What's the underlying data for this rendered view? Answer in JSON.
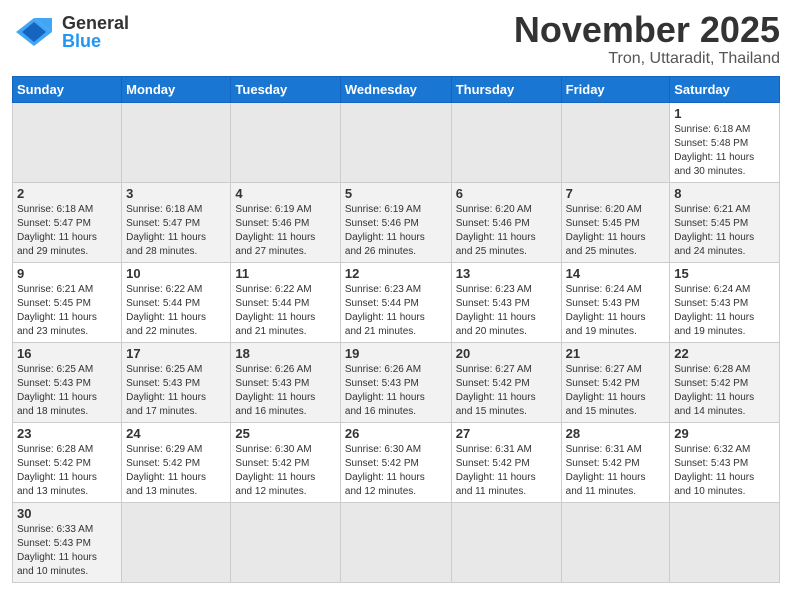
{
  "header": {
    "logo_general": "General",
    "logo_blue": "Blue",
    "month": "November 2025",
    "location": "Tron, Uttaradit, Thailand"
  },
  "weekdays": [
    "Sunday",
    "Monday",
    "Tuesday",
    "Wednesday",
    "Thursday",
    "Friday",
    "Saturday"
  ],
  "weeks": [
    [
      {
        "day": "",
        "info": ""
      },
      {
        "day": "",
        "info": ""
      },
      {
        "day": "",
        "info": ""
      },
      {
        "day": "",
        "info": ""
      },
      {
        "day": "",
        "info": ""
      },
      {
        "day": "",
        "info": ""
      },
      {
        "day": "1",
        "info": "Sunrise: 6:18 AM\nSunset: 5:48 PM\nDaylight: 11 hours\nand 30 minutes."
      }
    ],
    [
      {
        "day": "2",
        "info": "Sunrise: 6:18 AM\nSunset: 5:47 PM\nDaylight: 11 hours\nand 29 minutes."
      },
      {
        "day": "3",
        "info": "Sunrise: 6:18 AM\nSunset: 5:47 PM\nDaylight: 11 hours\nand 28 minutes."
      },
      {
        "day": "4",
        "info": "Sunrise: 6:19 AM\nSunset: 5:46 PM\nDaylight: 11 hours\nand 27 minutes."
      },
      {
        "day": "5",
        "info": "Sunrise: 6:19 AM\nSunset: 5:46 PM\nDaylight: 11 hours\nand 26 minutes."
      },
      {
        "day": "6",
        "info": "Sunrise: 6:20 AM\nSunset: 5:46 PM\nDaylight: 11 hours\nand 25 minutes."
      },
      {
        "day": "7",
        "info": "Sunrise: 6:20 AM\nSunset: 5:45 PM\nDaylight: 11 hours\nand 25 minutes."
      },
      {
        "day": "8",
        "info": "Sunrise: 6:21 AM\nSunset: 5:45 PM\nDaylight: 11 hours\nand 24 minutes."
      }
    ],
    [
      {
        "day": "9",
        "info": "Sunrise: 6:21 AM\nSunset: 5:45 PM\nDaylight: 11 hours\nand 23 minutes."
      },
      {
        "day": "10",
        "info": "Sunrise: 6:22 AM\nSunset: 5:44 PM\nDaylight: 11 hours\nand 22 minutes."
      },
      {
        "day": "11",
        "info": "Sunrise: 6:22 AM\nSunset: 5:44 PM\nDaylight: 11 hours\nand 21 minutes."
      },
      {
        "day": "12",
        "info": "Sunrise: 6:23 AM\nSunset: 5:44 PM\nDaylight: 11 hours\nand 21 minutes."
      },
      {
        "day": "13",
        "info": "Sunrise: 6:23 AM\nSunset: 5:43 PM\nDaylight: 11 hours\nand 20 minutes."
      },
      {
        "day": "14",
        "info": "Sunrise: 6:24 AM\nSunset: 5:43 PM\nDaylight: 11 hours\nand 19 minutes."
      },
      {
        "day": "15",
        "info": "Sunrise: 6:24 AM\nSunset: 5:43 PM\nDaylight: 11 hours\nand 19 minutes."
      }
    ],
    [
      {
        "day": "16",
        "info": "Sunrise: 6:25 AM\nSunset: 5:43 PM\nDaylight: 11 hours\nand 18 minutes."
      },
      {
        "day": "17",
        "info": "Sunrise: 6:25 AM\nSunset: 5:43 PM\nDaylight: 11 hours\nand 17 minutes."
      },
      {
        "day": "18",
        "info": "Sunrise: 6:26 AM\nSunset: 5:43 PM\nDaylight: 11 hours\nand 16 minutes."
      },
      {
        "day": "19",
        "info": "Sunrise: 6:26 AM\nSunset: 5:43 PM\nDaylight: 11 hours\nand 16 minutes."
      },
      {
        "day": "20",
        "info": "Sunrise: 6:27 AM\nSunset: 5:42 PM\nDaylight: 11 hours\nand 15 minutes."
      },
      {
        "day": "21",
        "info": "Sunrise: 6:27 AM\nSunset: 5:42 PM\nDaylight: 11 hours\nand 15 minutes."
      },
      {
        "day": "22",
        "info": "Sunrise: 6:28 AM\nSunset: 5:42 PM\nDaylight: 11 hours\nand 14 minutes."
      }
    ],
    [
      {
        "day": "23",
        "info": "Sunrise: 6:28 AM\nSunset: 5:42 PM\nDaylight: 11 hours\nand 13 minutes."
      },
      {
        "day": "24",
        "info": "Sunrise: 6:29 AM\nSunset: 5:42 PM\nDaylight: 11 hours\nand 13 minutes."
      },
      {
        "day": "25",
        "info": "Sunrise: 6:30 AM\nSunset: 5:42 PM\nDaylight: 11 hours\nand 12 minutes."
      },
      {
        "day": "26",
        "info": "Sunrise: 6:30 AM\nSunset: 5:42 PM\nDaylight: 11 hours\nand 12 minutes."
      },
      {
        "day": "27",
        "info": "Sunrise: 6:31 AM\nSunset: 5:42 PM\nDaylight: 11 hours\nand 11 minutes."
      },
      {
        "day": "28",
        "info": "Sunrise: 6:31 AM\nSunset: 5:42 PM\nDaylight: 11 hours\nand 11 minutes."
      },
      {
        "day": "29",
        "info": "Sunrise: 6:32 AM\nSunset: 5:43 PM\nDaylight: 11 hours\nand 10 minutes."
      }
    ],
    [
      {
        "day": "30",
        "info": "Sunrise: 6:33 AM\nSunset: 5:43 PM\nDaylight: 11 hours\nand 10 minutes."
      },
      {
        "day": "",
        "info": ""
      },
      {
        "day": "",
        "info": ""
      },
      {
        "day": "",
        "info": ""
      },
      {
        "day": "",
        "info": ""
      },
      {
        "day": "",
        "info": ""
      },
      {
        "day": "",
        "info": ""
      }
    ]
  ]
}
